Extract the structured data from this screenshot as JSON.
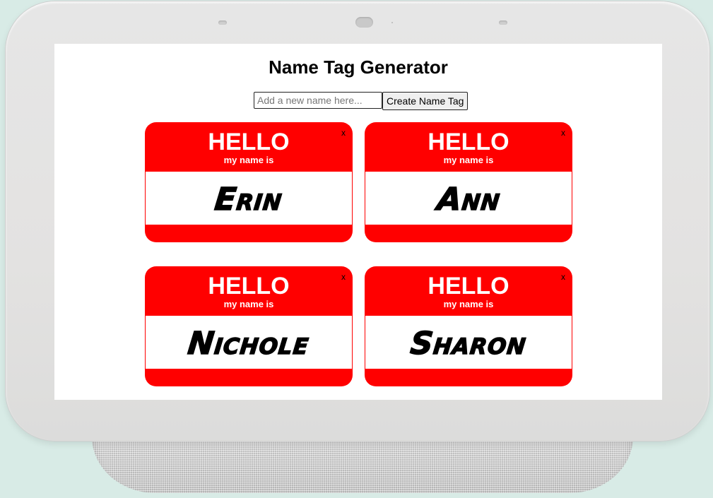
{
  "app": {
    "title": "Name Tag Generator"
  },
  "form": {
    "input_value": "",
    "input_placeholder": "Add a new name here...",
    "create_button_label": "Create Name Tag"
  },
  "tags": [
    {
      "hello": "HELLO",
      "subtitle": "my name is",
      "name": "Erin",
      "remove_label": "x"
    },
    {
      "hello": "HELLO",
      "subtitle": "my name is",
      "name": "Ann",
      "remove_label": "x"
    },
    {
      "hello": "HELLO",
      "subtitle": "my name is",
      "name": "Nichole",
      "remove_label": "x"
    },
    {
      "hello": "HELLO",
      "subtitle": "my name is",
      "name": "Sharon",
      "remove_label": "x"
    }
  ],
  "colors": {
    "tag_red": "#ff0000",
    "background": "#d8ebe6",
    "screen": "#ffffff"
  }
}
